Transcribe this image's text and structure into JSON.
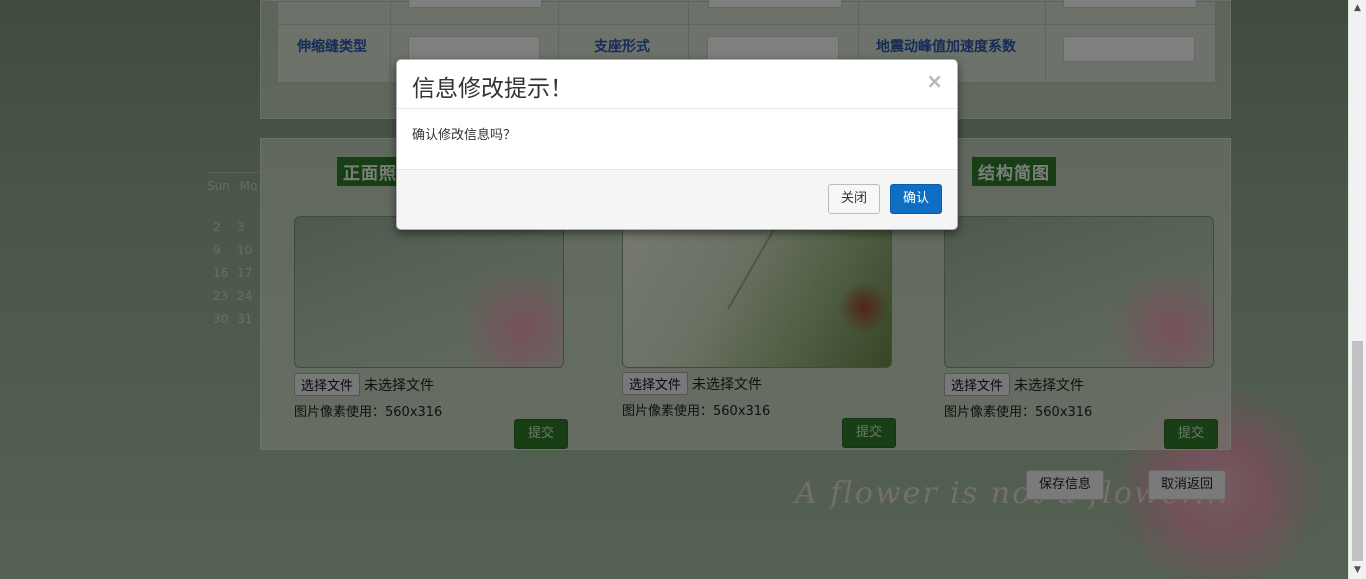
{
  "form": {
    "fields": [
      {
        "label": "伸缩缝类型",
        "value": ""
      },
      {
        "label": "支座形式",
        "value": ""
      },
      {
        "label": "地震动峰值加速度系数",
        "value": ""
      }
    ]
  },
  "calendar": {
    "day_headers": [
      "Sun",
      "Mo"
    ],
    "rows": [
      [
        "2",
        "3"
      ],
      [
        "9",
        "10"
      ],
      [
        "16",
        "17"
      ],
      [
        "23",
        "24"
      ],
      [
        "30",
        "31"
      ]
    ]
  },
  "photos": {
    "sections": [
      {
        "title": "正面照",
        "file_button": "选择文件",
        "file_status": "未选择文件",
        "hint": "图片像素使用：560x316",
        "submit": "提交"
      },
      {
        "title": "",
        "file_button": "选择文件",
        "file_status": "未选择文件",
        "hint": "图片像素使用：560x316",
        "submit": "提交"
      },
      {
        "title": "结构简图",
        "file_button": "选择文件",
        "file_status": "未选择文件",
        "hint": "图片像素使用：560x316",
        "submit": "提交"
      }
    ]
  },
  "actions": {
    "save": "保存信息",
    "cancel": "取消返回"
  },
  "background": {
    "script_text": "A flower is not a flower..."
  },
  "modal": {
    "title": "信息修改提示！",
    "close_symbol": "×",
    "message": "确认修改信息吗？",
    "close_button": "关闭",
    "confirm_button": "确认"
  },
  "scrollbar": {
    "up": "▲",
    "down": "▼"
  },
  "colors": {
    "primary": "#0e6ec4",
    "label_blue": "#2b58b0",
    "section_green": "#2f7d2b"
  }
}
